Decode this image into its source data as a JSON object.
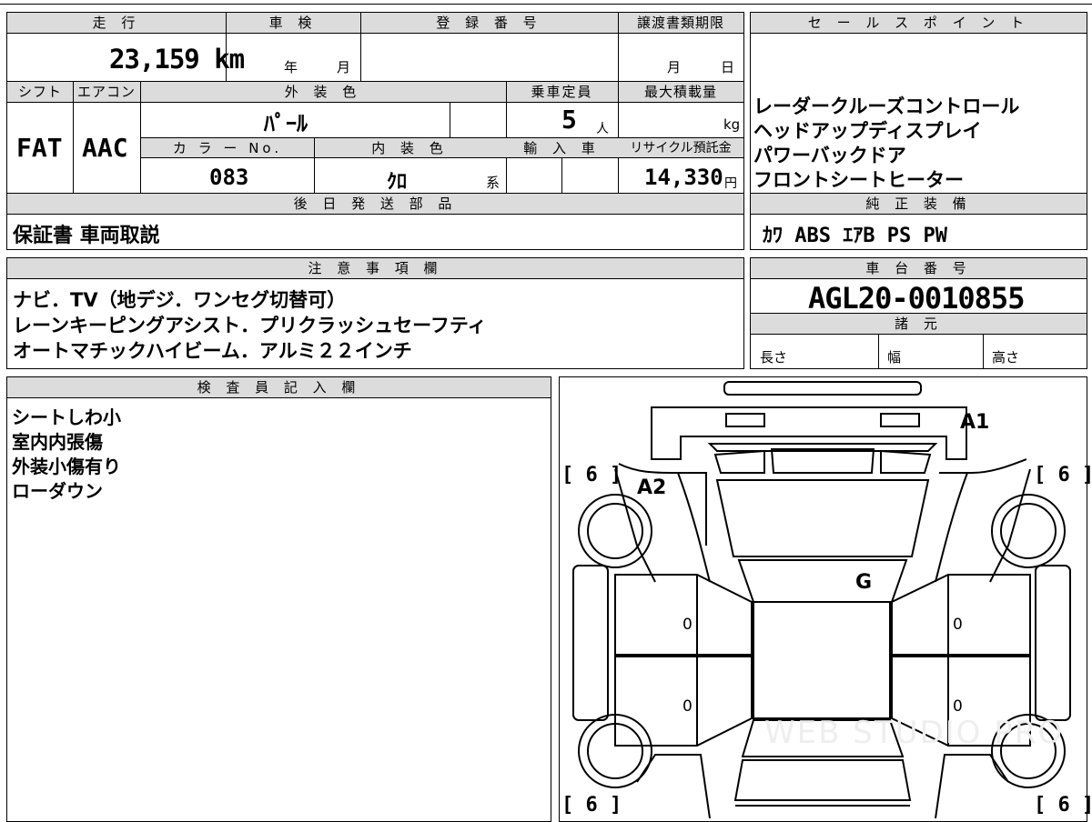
{
  "top": {
    "mileage_label": "走 行",
    "mileage_value": "23,159 km",
    "inspection_label": "車 検",
    "inspection_year_unit": "年",
    "inspection_month_unit": "月",
    "registration_label": "登 録 番 号",
    "transfer_deadline_label": "譲渡書類期限",
    "transfer_month_unit": "月",
    "transfer_day_unit": "日",
    "shift_label": "シフト",
    "shift_value": "FAT",
    "aircon_label": "エアコン",
    "aircon_value": "AAC",
    "exterior_color_label": "外 装 色",
    "exterior_color_value": "ﾊﾟｰﾙ",
    "capacity_label": "乗車定員",
    "capacity_value": "5",
    "capacity_unit": "人",
    "max_load_label": "最大積載量",
    "max_load_unit": "kg",
    "color_no_label": "カ ラ ー No.",
    "color_no_value": "083",
    "interior_color_label": "内 装 色",
    "interior_color_value": "ｸﾛ",
    "interior_color_suffix": "系",
    "import_label": "輸 入 車",
    "recycle_label": "リサイクル預託金",
    "recycle_value": "14,330",
    "recycle_unit": "円",
    "later_parts_label": "後 日 発 送 部 品",
    "later_parts_value": "保証書 車両取説"
  },
  "sales_points": {
    "label": "セ ー ル ス ポ イ ン ト",
    "items": [
      "レーダークルーズコントロール",
      "ヘッドアップディスプレイ",
      "パワーバックドア",
      "フロントシートヒーター"
    ]
  },
  "genuine_equipment": {
    "label": "純 正 装 備",
    "value": "ｶﾜ ABS ｴｱB PS PW"
  },
  "notes": {
    "label": "注 意 事 項 欄",
    "lines": [
      "ナビ．TV（地デジ．ワンセグ切替可）",
      "レーンキーピングアシスト．プリクラッシュセーフティ",
      "オートマチックハイビーム．アルミ２２インチ"
    ]
  },
  "chassis": {
    "label": "車 台 番 号",
    "value": "AGL20-0010855",
    "specs_label": "諸 元",
    "length_label": "長さ",
    "width_label": "幅",
    "height_label": "高さ"
  },
  "inspector": {
    "label": "検 査 員 記 入 欄",
    "lines": [
      "シートしわ小",
      "室内内張傷",
      "外装小傷有り",
      "ローダウン"
    ]
  },
  "diagram": {
    "marks": [
      "A1",
      "A2",
      "G"
    ],
    "tire_tl": "[ 6 ]",
    "tire_tr": "[ 6 ]",
    "tire_bl": "[ 6 ]",
    "tire_br": "[ 6 ]",
    "door_values": [
      "0",
      "0",
      "0",
      "0"
    ],
    "watermark": "WEB STUDIO PRO"
  }
}
